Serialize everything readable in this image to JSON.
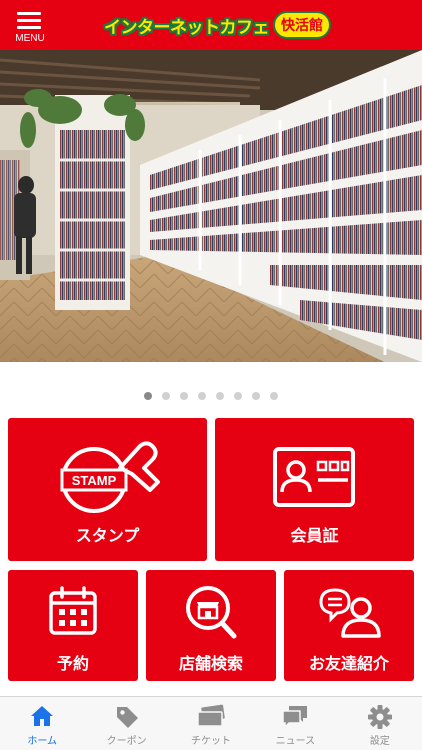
{
  "header": {
    "menu_label": "MENU",
    "logo_text": "インターネットカフェ",
    "logo_badge_text": "快活館"
  },
  "carousel": {
    "page_count": 8,
    "active_index": 0
  },
  "tiles": {
    "stamp": "スタンプ",
    "stamp_icon_text": "STAMP",
    "member_card": "会員証",
    "reservation": "予約",
    "store_search": "店舗検索",
    "friend_referral": "お友達紹介"
  },
  "tabbar": {
    "home": "ホーム",
    "coupon": "クーポン",
    "ticket": "チケット",
    "news": "ニュース",
    "settings": "設定"
  },
  "colors": {
    "brand_red": "#e50012",
    "tab_active": "#1a73e8",
    "tab_inactive": "#8e8e8e"
  },
  "icons": [
    "hamburger-menu-icon",
    "stamp-icon",
    "member-card-icon",
    "calendar-icon",
    "store-search-icon",
    "friend-referral-icon",
    "home-icon",
    "coupon-tag-icon",
    "ticket-icon",
    "news-icon",
    "gear-icon"
  ]
}
